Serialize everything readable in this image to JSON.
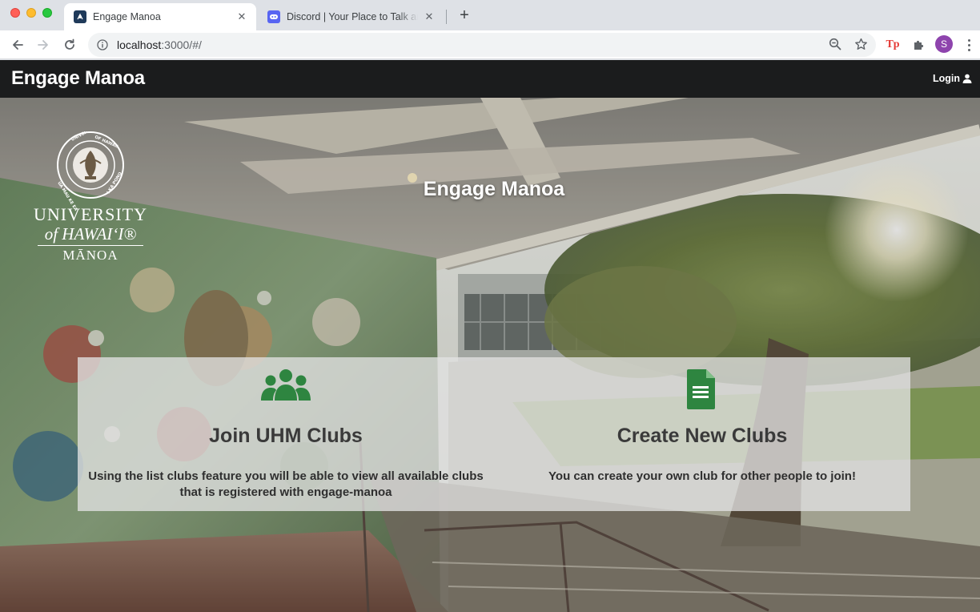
{
  "browser": {
    "tabs": [
      {
        "title": "Engage Manoa",
        "active": true
      },
      {
        "title": "Discord | Your Place to Talk and Hang Out",
        "active": false
      }
    ],
    "url_host": "localhost",
    "url_rest": ":3000/#/",
    "profile_initial": "S",
    "extension_label": "Tp"
  },
  "navbar": {
    "brand": "Engage Manoa",
    "login_label": "Login"
  },
  "hero": {
    "title": "Engage Manoa",
    "logo_lines": [
      "UNIVERSITY",
      "of HAWAIʻI®",
      "MĀNOA"
    ],
    "seal_text": "UNIVERSITY OF HAWAIʻI"
  },
  "features": [
    {
      "icon": "users-icon",
      "heading": "Join UHM Clubs",
      "text_line1": "Using the list clubs feature you will be able to view all available clubs",
      "text_line2": "that is registered with engage-manoa"
    },
    {
      "icon": "document-icon",
      "heading": "Create New Clubs",
      "text_line1": "You can create your own club for other people to join!"
    }
  ],
  "colors": {
    "navbar_bg": "#1b1c1d",
    "icon_green": "#2e8540",
    "heading_text": "#3a3a3a"
  }
}
